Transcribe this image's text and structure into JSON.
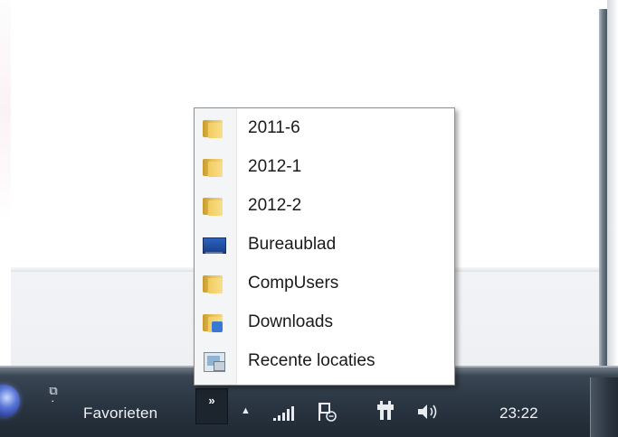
{
  "taskbar": {
    "toolbar_label": "Favorieten",
    "chevron_label": "»",
    "clock": "23:22",
    "icons": [
      "start-orb",
      "toolbar-handle",
      "tray-expand-arrow",
      "network-signal-icon",
      "action-center-flag-icon",
      "power-icon",
      "volume-icon"
    ]
  },
  "popup_menu": {
    "items": [
      {
        "label": "2011-6",
        "icon": "folder-icon"
      },
      {
        "label": "2012-1",
        "icon": "folder-icon"
      },
      {
        "label": "2012-2",
        "icon": "folder-icon"
      },
      {
        "label": "Bureaublad",
        "icon": "desktop-icon"
      },
      {
        "label": "CompUsers",
        "icon": "folder-icon"
      },
      {
        "label": "Downloads",
        "icon": "downloads-folder-icon"
      },
      {
        "label": "Recente locaties",
        "icon": "recent-places-icon"
      }
    ]
  },
  "colors": {
    "taskbar": "#2a3542",
    "popup_border": "#8f8f8f",
    "folder": "#e8c25a"
  }
}
